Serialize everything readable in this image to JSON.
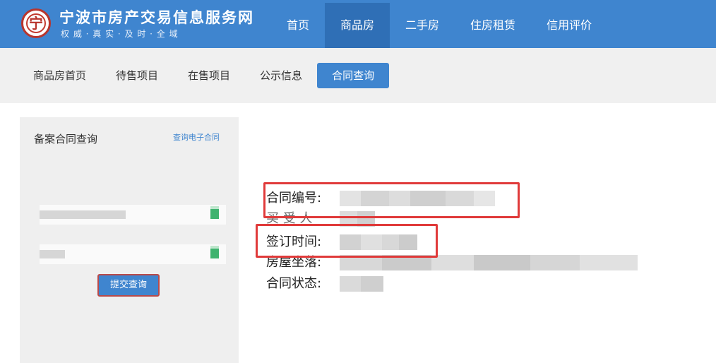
{
  "header": {
    "logo_glyph": "宁",
    "site_title": "宁波市房产交易信息服务网",
    "slogan": "权 威 · 真 实 · 及 时 · 全 域",
    "nav": [
      {
        "label": "首页",
        "active": false
      },
      {
        "label": "商品房",
        "active": true
      },
      {
        "label": "二手房",
        "active": false
      },
      {
        "label": "住房租赁",
        "active": false
      },
      {
        "label": "信用评价",
        "active": false
      }
    ]
  },
  "subnav": {
    "items": [
      {
        "label": "商品房首页",
        "active": false
      },
      {
        "label": "待售项目",
        "active": false
      },
      {
        "label": "在售项目",
        "active": false
      },
      {
        "label": "公示信息",
        "active": false
      },
      {
        "label": "合同查询",
        "active": true
      }
    ]
  },
  "query_panel": {
    "title": "备案合同查询",
    "link": "查询电子合同",
    "submit_label": "提交查询"
  },
  "contract": {
    "fields": [
      {
        "label": "合同编号:",
        "highlighted": true
      },
      {
        "label": "买 受 人",
        "highlighted": false
      },
      {
        "label": "签订时间:",
        "highlighted": true
      },
      {
        "label": "房屋坐落:",
        "highlighted": false
      },
      {
        "label": "合同状态:",
        "highlighted": false
      }
    ]
  },
  "colors": {
    "brand_blue": "#3f85cf",
    "nav_active": "#2f6fb6",
    "highlight_red": "#e03a3a",
    "button_green": "#3fb36f"
  }
}
